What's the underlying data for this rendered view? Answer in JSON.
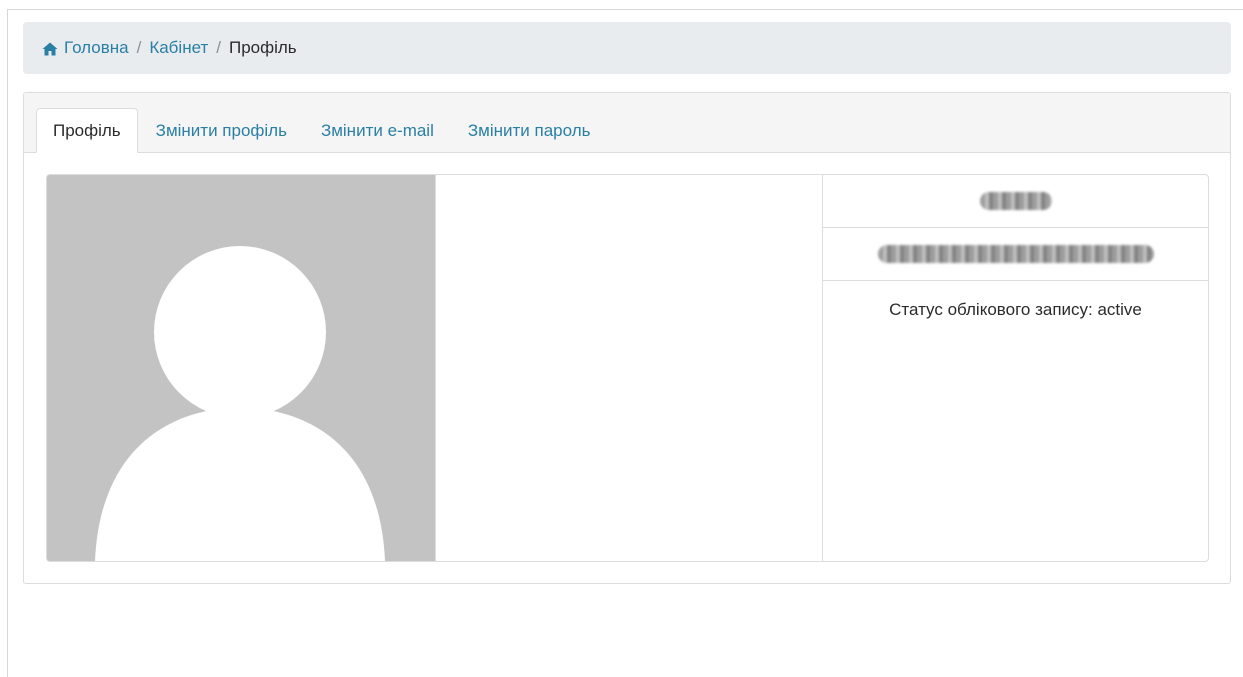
{
  "breadcrumb": {
    "home_label": "Головна",
    "cabinet_label": "Кабінет",
    "current_label": "Профіль",
    "separator": "/"
  },
  "tabs": [
    {
      "label": "Профіль",
      "active": true
    },
    {
      "label": "Змінити профіль",
      "active": false
    },
    {
      "label": "Змінити e-mail",
      "active": false
    },
    {
      "label": "Змінити пароль",
      "active": false
    }
  ],
  "profile": {
    "status_text": "Статус облікового запису: active",
    "name_redacted": "",
    "email_redacted": ""
  },
  "colors": {
    "link": "#2a7fa5",
    "breadcrumb_bg": "#e9ecef",
    "avatar_bg": "#c3c3c3"
  },
  "icons": {
    "home": "home-icon",
    "avatar": "default-user-avatar"
  }
}
